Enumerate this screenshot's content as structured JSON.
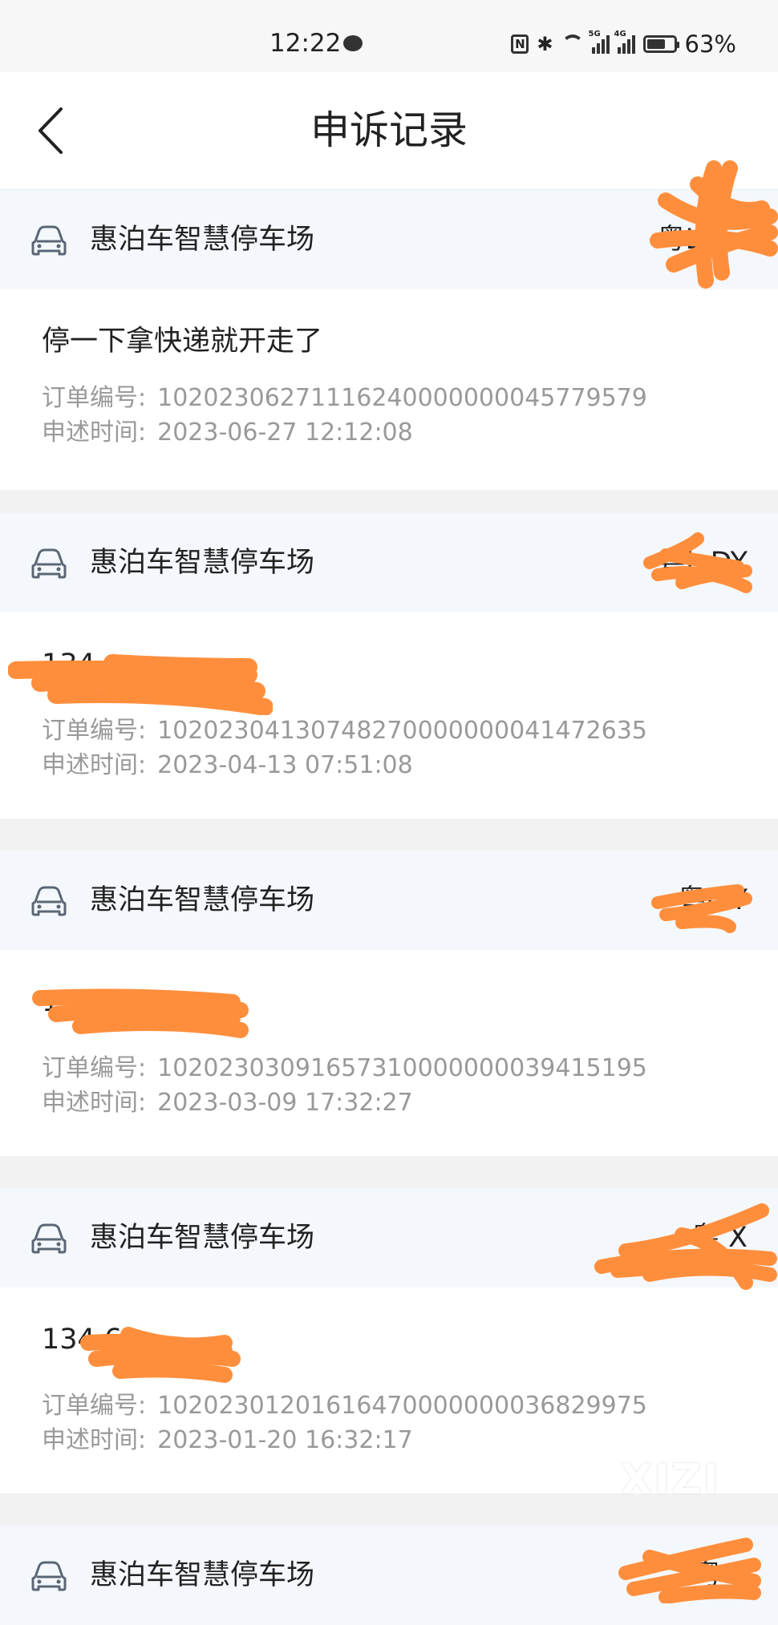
{
  "status_bar": {
    "time": "12:22",
    "battery": "63%",
    "network1": "5G",
    "network2": "4G"
  },
  "nav": {
    "title": "申诉记录"
  },
  "labels": {
    "order_no": "订单编号:",
    "time": "申述时间:"
  },
  "records": [
    {
      "lot": "惠泊车智慧停车场",
      "plate": "粤L",
      "content": "停一下拿快递就开走了",
      "order_no": "10202306271116240000000045779579",
      "time": "2023-06-27 12:12:08"
    },
    {
      "lot": "惠泊车智慧停车场",
      "plate": "粤L DY",
      "content": "134",
      "order_no": "10202304130748270000000041472635",
      "time": "2023-04-13 07:51:08"
    },
    {
      "lot": "惠泊车智慧停车场",
      "plate": "粤L Y",
      "content": "134",
      "order_no": "10202303091657310000000039415195",
      "time": "2023-03-09 17:32:27"
    },
    {
      "lot": "惠泊车智慧停车场",
      "plate": "粤 X",
      "content": "134 6",
      "order_no": "10202301201616470000000036829975",
      "time": "2023-01-20 16:32:17"
    },
    {
      "lot": "惠泊车智慧停车场",
      "plate": "粤 Y"
    }
  ],
  "watermark": "XIZI",
  "colors": {
    "scribble": "#ff8e3c",
    "header_bg": "#f4f8fc"
  }
}
